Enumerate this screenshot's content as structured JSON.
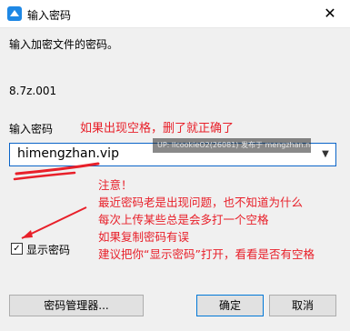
{
  "window": {
    "title": "输入密码",
    "close_glyph": "✕"
  },
  "prompt": "输入加密文件的密码。",
  "file_name": "8.7z.001",
  "password_label": "输入密码",
  "password_value": "himengzhan.vip",
  "annotations": {
    "top": "如果出现空格，删了就正确了",
    "note_lines": [
      "注意！",
      "最近密码老是出现问题，也不知道为什么",
      "每次上传某些总是会多打一个空格",
      "如果复制密码有误",
      "建议把你“显示密码”打开，看看是否有空格"
    ]
  },
  "watermark": "UP: llcookieO2(26081) 发布于 mengzhan.net",
  "show_password": {
    "label": "显示密码",
    "checked": true
  },
  "buttons": {
    "manager": "密码管理器...",
    "ok": "确定",
    "cancel": "取消"
  },
  "colors": {
    "annotation": "#e8202a",
    "focus_border": "#0a64c8"
  }
}
